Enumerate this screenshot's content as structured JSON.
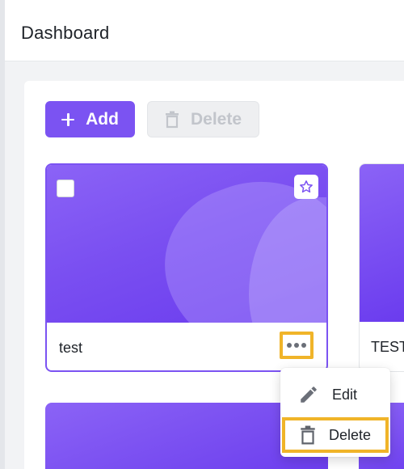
{
  "header": {
    "title": "Dashboard"
  },
  "toolbar": {
    "add_label": "Add",
    "delete_label": "Delete"
  },
  "cards": [
    {
      "title": "test",
      "favorite_icon": "star-outline-icon",
      "more_icon": "more-horizontal-icon"
    },
    {
      "title": "TEST"
    }
  ],
  "context_menu": {
    "items": [
      {
        "label": "Edit",
        "icon": "pencil-icon"
      },
      {
        "label": "Delete",
        "icon": "trash-icon"
      }
    ]
  },
  "colors": {
    "accent": "#7b53f2",
    "highlight": "#f0b429"
  }
}
